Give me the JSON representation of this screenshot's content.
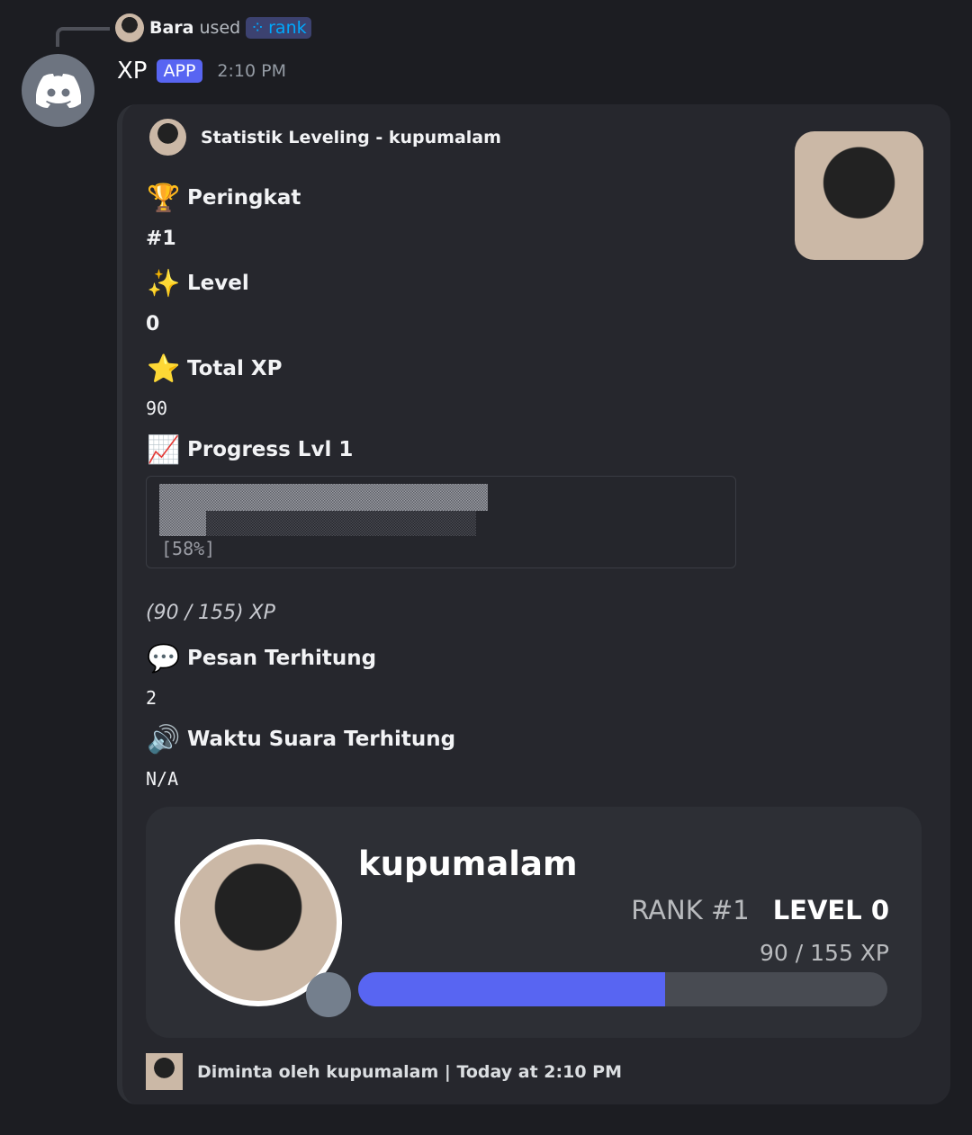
{
  "reply": {
    "user": "Bara",
    "used": "used",
    "command": "rank"
  },
  "message": {
    "author": "XP",
    "badge": "APP",
    "time": "2:10 PM"
  },
  "embed": {
    "author": "Statistik Leveling - kupumalam",
    "fields": [
      {
        "icon": "trophy-icon",
        "emoji": "🏆",
        "name": "Peringkat",
        "value": "#1"
      },
      {
        "icon": "sparkles-icon",
        "emoji": "✨",
        "name": "Level",
        "value": "0"
      },
      {
        "icon": "star-icon",
        "emoji": "⭐",
        "name": "Total XP",
        "value": "90"
      },
      {
        "icon": "chart-increasing-icon",
        "emoji": "📈",
        "name": "Progress Lvl 1"
      },
      {
        "icon": "speech-balloon-icon",
        "emoji": "💬",
        "name": "Pesan Terhitung",
        "value": "2"
      },
      {
        "icon": "speaker-icon",
        "emoji": "🔊",
        "name": "Waktu Suara Terhitung",
        "value": "N/A"
      }
    ],
    "progress_block": {
      "label": "[58%]",
      "fraction": 0.58
    },
    "xp_text": "(90 / 155) XP",
    "footer": "Diminta oleh kupumalam | Today at 2:10 PM"
  },
  "rank_card": {
    "username": "kupumalam",
    "rank": "RANK #1",
    "level": "LEVEL 0",
    "xp": "90 / 155 XP",
    "progress": 0.58,
    "accent": "#5865f2",
    "status_color": "#747f8d"
  }
}
